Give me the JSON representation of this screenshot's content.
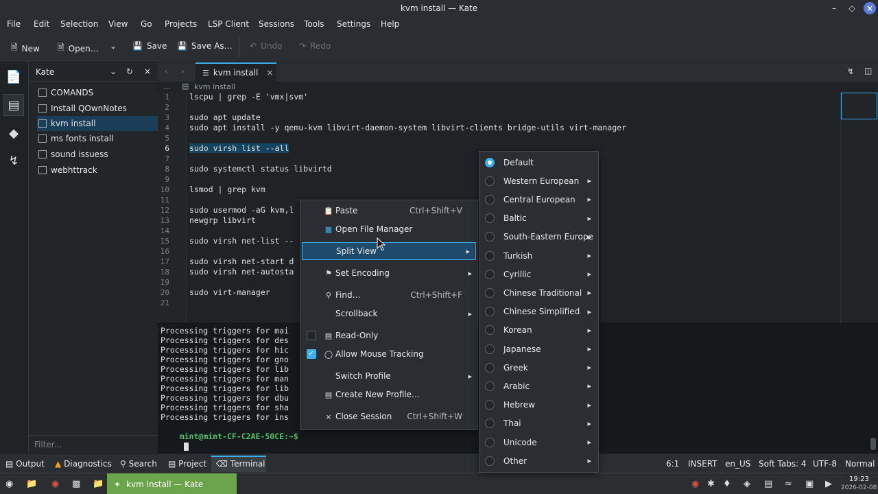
{
  "window": {
    "title": "kvm install  — Kate"
  },
  "menubar": [
    "File",
    "Edit",
    "Selection",
    "View",
    "Go",
    "Projects",
    "LSP Client",
    "Sessions",
    "Tools",
    "Settings",
    "Help"
  ],
  "toolbar": {
    "new": "New",
    "open": "Open…",
    "save": "Save",
    "save_as": "Save As…",
    "undo": "Undo",
    "redo": "Redo"
  },
  "sidebar": {
    "title": "Kate",
    "files": [
      "COMANDS",
      "Install QOwnNotes",
      "kvm install",
      "ms fonts install",
      "sound issuess",
      "webhttrack"
    ],
    "selected_index": 2,
    "filter_placeholder": "Filter..."
  },
  "tab": {
    "label": "kvm install"
  },
  "breadcrumb": {
    "dots": "...",
    "file": "kvm install"
  },
  "editor": {
    "lines": [
      "lscpu | grep -E 'vmx|svm'",
      "",
      "sudo apt update",
      "sudo apt install -y qemu-kvm libvirt-daemon-system libvirt-clients bridge-utils virt-manager",
      "",
      "sudo virsh list --all",
      "",
      "sudo systemctl status libvirtd",
      "",
      "lsmod | grep kvm",
      "",
      "sudo usermod -aG kvm,l",
      "newgrp libvirt",
      "",
      "sudo virsh net-list --",
      "",
      "sudo virsh net-start d",
      "sudo virsh net-autosta",
      "",
      "sudo virt-manager",
      ""
    ],
    "line_numbers": [
      "1",
      "2",
      "3",
      "4",
      "5",
      "6",
      "7",
      "8",
      "9",
      "10",
      "11",
      "12",
      "13",
      "14",
      "15",
      "16",
      "17",
      "18",
      "19",
      "20",
      "21"
    ],
    "current_line": 6
  },
  "terminal": {
    "lines": [
      "Processing triggers for mai",
      "Processing triggers for des",
      "Processing triggers for hic",
      "Processing triggers for gno",
      "Processing triggers for lib",
      "Processing triggers for man",
      "Processing triggers for lib",
      "Processing triggers for dbu",
      "Processing triggers for sha",
      "Processing triggers for ins"
    ],
    "prompt": "mint@mint-CF-C2AE-50CE:~$"
  },
  "context_menu": {
    "paste": "Paste",
    "paste_shortcut": "Ctrl+Shift+V",
    "open_fm": "Open File Manager",
    "split_view": "Split View",
    "set_encoding": "Set Encoding",
    "find": "Find…",
    "find_shortcut": "Ctrl+Shift+F",
    "scrollback": "Scrollback",
    "read_only": "Read-Only",
    "mouse_tracking": "Allow Mouse Tracking",
    "switch_profile": "Switch Profile",
    "new_profile": "Create New Profile…",
    "close_session": "Close Session",
    "close_shortcut": "Ctrl+Shift+W"
  },
  "encoding_menu": [
    "Default",
    "Western European",
    "Central European",
    "Baltic",
    "South-Eastern Europe",
    "Turkish",
    "Cyrillic",
    "Chinese Traditional",
    "Chinese Simplified",
    "Korean",
    "Japanese",
    "Greek",
    "Arabic",
    "Hebrew",
    "Thai",
    "Unicode",
    "Other"
  ],
  "statusbar": {
    "output": "Output",
    "diagnostics": "Diagnostics",
    "search": "Search",
    "project": "Project",
    "terminal": "Terminal",
    "position": "6:1",
    "mode": "INSERT",
    "lang": "en_US",
    "tabs": "Soft Tabs: 4",
    "encoding": "UTF-8",
    "eol": "Normal"
  },
  "taskbar": {
    "kate_label": "kvm install — Kate",
    "time": "19:23",
    "date": "2026-02-08"
  },
  "colors": {
    "accent": "#3daee9",
    "selection": "#1b3d58",
    "taskbar_active": "#6ca44b",
    "prompt": "#4ec26b"
  }
}
